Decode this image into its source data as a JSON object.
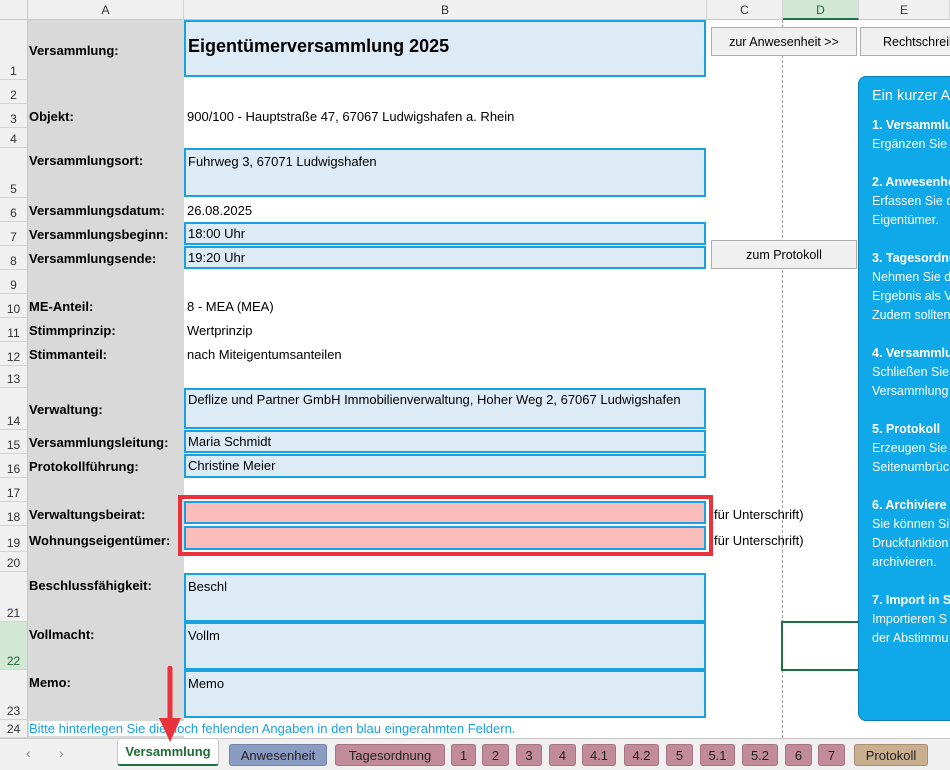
{
  "columns": [
    "A",
    "B",
    "C",
    "D",
    "E"
  ],
  "rows": [
    "1",
    "2",
    "3",
    "4",
    "5",
    "6",
    "7",
    "8",
    "9",
    "10",
    "11",
    "12",
    "13",
    "14",
    "15",
    "16",
    "17",
    "18",
    "19",
    "20",
    "21",
    "22",
    "23",
    "24"
  ],
  "buttons": {
    "anwesenheit": "zur Anwesenheit >>",
    "rechtschreibung": "Rechtschreibung",
    "protokoll": "zum Protokoll"
  },
  "fields": {
    "versammlung": {
      "label": "Versammlung:",
      "value": "Eigentümerversammlung 2025"
    },
    "objekt": {
      "label": "Objekt:",
      "value": "900/100 - Hauptstraße 47, 67067 Ludwigshafen a. Rhein"
    },
    "ort": {
      "label": "Versammlungsort:",
      "value": "Fuhrweg 3, 67071 Ludwigshafen"
    },
    "datum": {
      "label": "Versammlungsdatum:",
      "value": "26.08.2025"
    },
    "beginn": {
      "label": "Versammlungsbeginn:",
      "value": "18:00 Uhr"
    },
    "ende": {
      "label": "Versammlungsende:",
      "value": "19:20 Uhr"
    },
    "me_anteil": {
      "label": "ME-Anteil:",
      "value": "8 - MEA (MEA)"
    },
    "stimmprinzip": {
      "label": "Stimmprinzip:",
      "value": "Wertprinzip"
    },
    "stimmanteil": {
      "label": "Stimmanteil:",
      "value": "nach Miteigentumsanteilen"
    },
    "verwaltung": {
      "label": "Verwaltung:",
      "value": "Deflize und Partner GmbH Immobilienverwaltung, Hoher Weg 2, 67067 Ludwigshafen"
    },
    "leitung": {
      "label": "Versammlungsleitung:",
      "value": "Maria Schmidt"
    },
    "protokollfuehrung": {
      "label": "Protokollführung:",
      "value": "Christine Meier"
    },
    "beirat": {
      "label": "Verwaltungsbeirat:",
      "value": "",
      "note": "für Unterschrift)"
    },
    "eigentuemer": {
      "label": "Wohnungseigentümer:",
      "value": "",
      "note": "für Unterschrift)"
    },
    "beschluss": {
      "label": "Beschlussfähigkeit:",
      "value": "Beschl"
    },
    "vollmacht": {
      "label": "Vollmacht:",
      "value": "Vollm"
    },
    "memo": {
      "label": "Memo:",
      "value": "Memo"
    }
  },
  "hint": "Bitte hinterlegen Sie die noch fehlenden Angaben in den blau eingerahmten Feldern.",
  "info": {
    "title": "Ein kurzer A",
    "items": [
      {
        "h": "1. Versammlu",
        "t": [
          "Ergänzen Sie"
        ]
      },
      {
        "h": "2. Anwesenhe",
        "t": [
          "Erfassen Sie d",
          "Eigentümer."
        ]
      },
      {
        "h": "3. Tagesordnu",
        "t": [
          "Nehmen Sie d",
          "Ergebnis als V",
          "Zudem sollten"
        ]
      },
      {
        "h": "4. Versammlu",
        "t": [
          "Schließen Sie",
          "Versammlung"
        ]
      },
      {
        "h": "5. Protokoll",
        "t": [
          "Erzeugen Sie",
          "Seitenumbrüc"
        ]
      },
      {
        "h": "6. Archiviere",
        "t": [
          "Sie können Si",
          "Druckfunktion",
          "archivieren."
        ]
      },
      {
        "h": "7. Import in S",
        "t": [
          "Importieren S",
          "der Abstimmu"
        ]
      }
    ]
  },
  "tabs": [
    "Versammlung",
    "Anwesenheit",
    "Tagesordnung",
    "1",
    "2",
    "3",
    "4",
    "4.1",
    "4.2",
    "5",
    "5.1",
    "5.2",
    "6",
    "7",
    "Protokoll"
  ],
  "colors": {
    "field_bg": "#ddebf7",
    "field_border": "#1aa1e0",
    "highlight": "#e8323c",
    "empty_field": "#fbbcbc",
    "info_bg": "#0fa8e8",
    "tab_pink": "#c28b9a",
    "tab_blue": "#8a9cc2",
    "tab_tan": "#c9ae8f"
  }
}
